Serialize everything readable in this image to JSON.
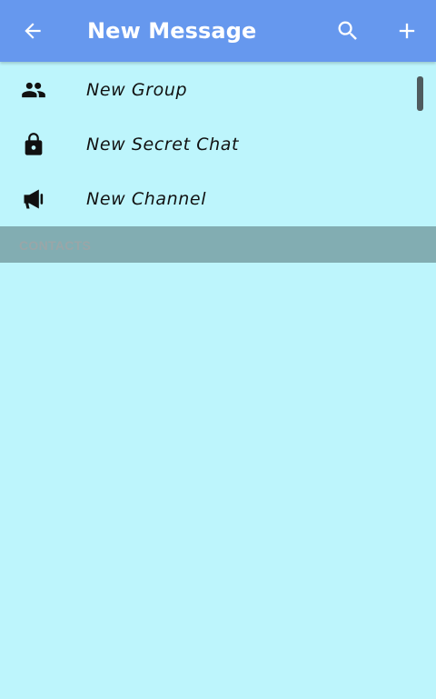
{
  "appbar": {
    "title": "New Message",
    "back_icon": "arrow-left-icon",
    "search_icon": "search-icon",
    "add_icon": "plus-icon",
    "background": "#6698ee"
  },
  "menu": {
    "items": [
      {
        "label": "New Group",
        "icon": "group-icon"
      },
      {
        "label": "New Secret Chat",
        "icon": "lock-icon"
      },
      {
        "label": "New Channel",
        "icon": "megaphone-icon"
      }
    ]
  },
  "contacts": {
    "header": "CONTACTS"
  },
  "colors": {
    "background": "#bdf5fc",
    "section_header": "#82adb2"
  }
}
